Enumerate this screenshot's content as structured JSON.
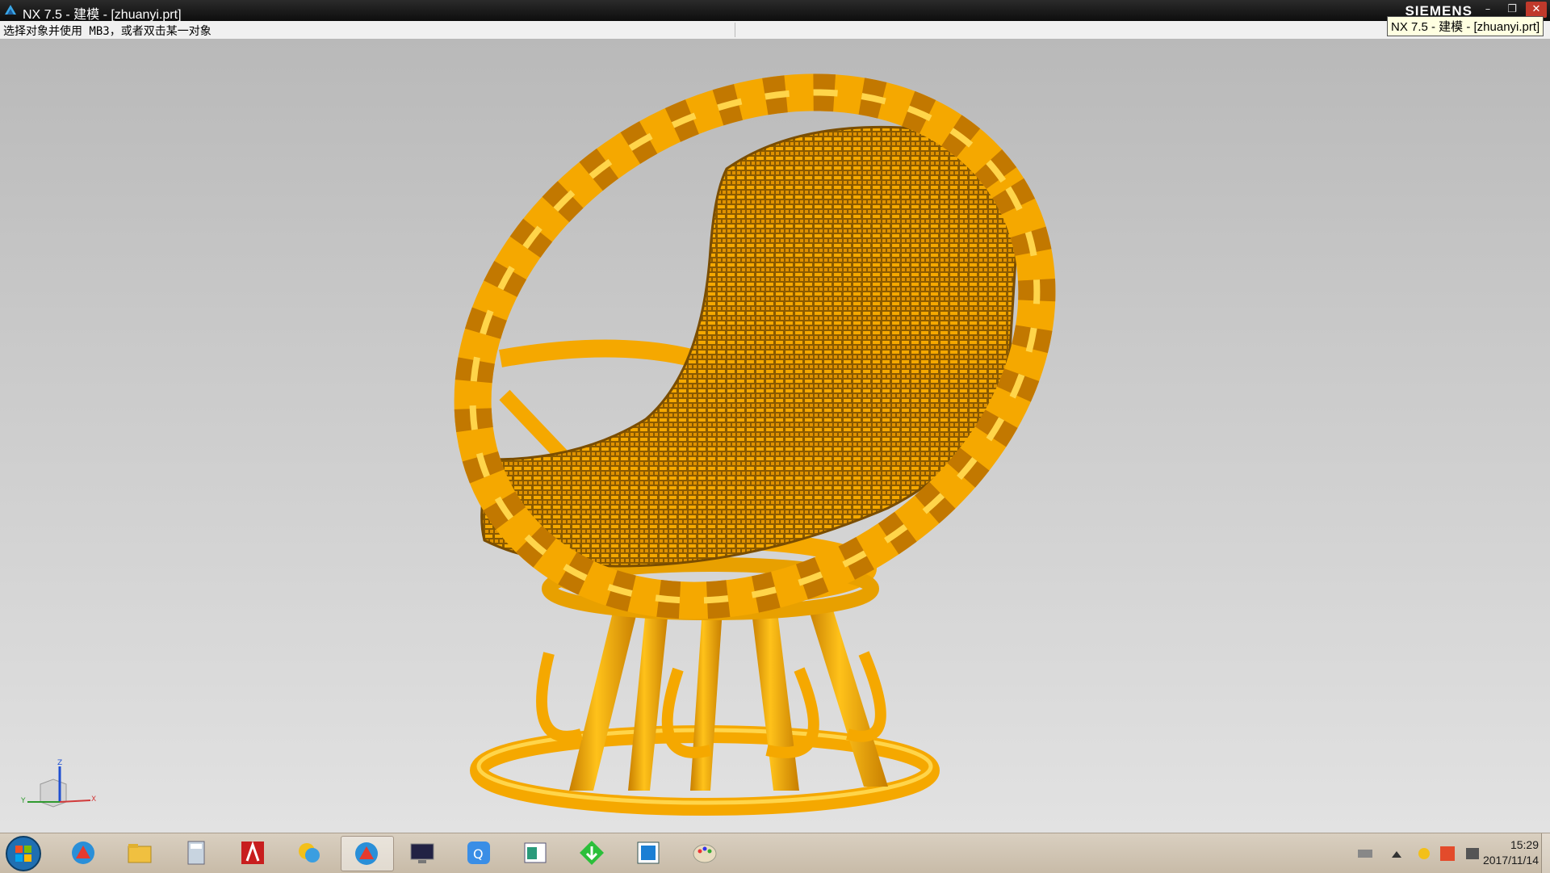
{
  "window": {
    "title": "NX 7.5 - 建模 - [zhuanyi.prt]",
    "brand": "SIEMENS",
    "minimize": "–",
    "maximize": "❐",
    "close": "✕"
  },
  "prompt": {
    "text": "选择对象并使用 MB3，或者双击某一对象"
  },
  "tooltip": {
    "text": "NX 7.5 - 建模 - [zhuanyi.prt]"
  },
  "viewport": {
    "model_color": "#f5a800",
    "model_highlight": "#ffd54a",
    "model_shadow": "#b86f00",
    "triad": {
      "x_label": "X",
      "y_label": "Y",
      "z_label": "Z"
    }
  },
  "taskbar": {
    "items": [
      {
        "name": "start-button",
        "icon": "windows-orb-icon"
      },
      {
        "name": "nx-app",
        "icon": "nx-icon"
      },
      {
        "name": "explorer",
        "icon": "folder-icon"
      },
      {
        "name": "calculator",
        "icon": "calculator-icon"
      },
      {
        "name": "autocad",
        "icon": "autocad-icon"
      },
      {
        "name": "qq-chat",
        "icon": "chat-icon"
      },
      {
        "name": "nx-window",
        "icon": "nx-icon",
        "active": true
      },
      {
        "name": "terminal",
        "icon": "monitor-icon"
      },
      {
        "name": "qq-pinyin",
        "icon": "input-icon"
      },
      {
        "name": "viewer",
        "icon": "window-icon"
      },
      {
        "name": "download",
        "icon": "download-icon"
      },
      {
        "name": "blue-app",
        "icon": "square-icon"
      },
      {
        "name": "paint",
        "icon": "palette-icon"
      }
    ],
    "clock": {
      "time": "15:29",
      "date": "2017/11/14"
    }
  }
}
